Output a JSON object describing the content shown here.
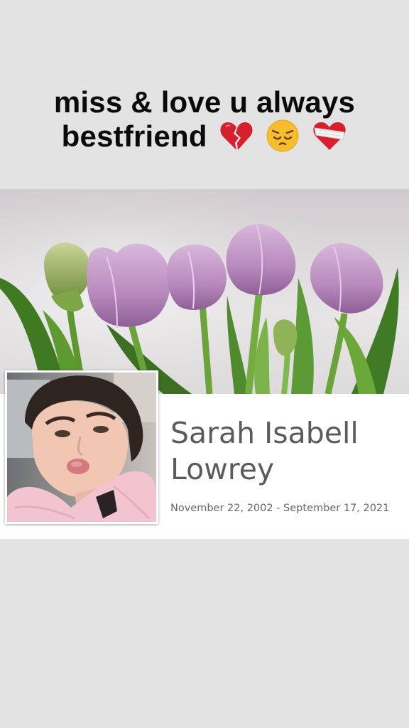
{
  "caption": {
    "line1": "miss & love u always",
    "line2": "bestfriend",
    "emojis": [
      "broken-heart-emoji",
      "pensive-face-emoji",
      "mending-heart-emoji"
    ]
  },
  "memorial": {
    "name": "Sarah Isabell Lowrey",
    "dates": "November 22, 2002 - September 17, 2021"
  },
  "colors": {
    "background": "#e3e3e3",
    "card": "#ffffff",
    "name_text": "#5b5b5b",
    "tulip": "#c9a3cc"
  }
}
